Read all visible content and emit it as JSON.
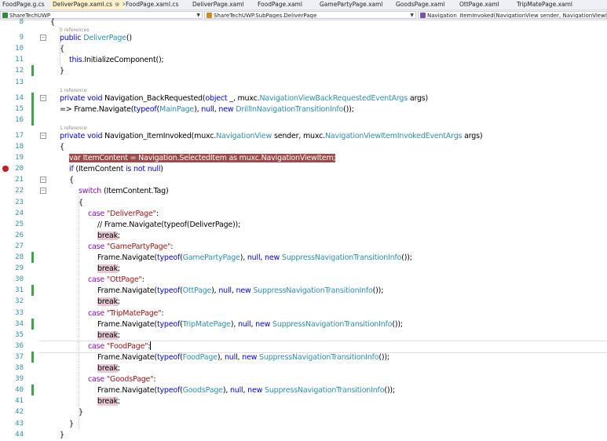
{
  "tabs": [
    {
      "label": "FoodPage.g.cs",
      "active": false
    },
    {
      "label": "DeliverPage.xaml.cs",
      "active": true,
      "pin": "⊕",
      "close": "✕"
    },
    {
      "label": "FoodPage.xaml.cs",
      "active": false
    },
    {
      "label": "DeliverPage.xaml",
      "active": false
    },
    {
      "label": "FoodPage.xaml",
      "active": false
    },
    {
      "label": "GamePartyPage.xaml",
      "active": false
    },
    {
      "label": "GoodsPage.xaml",
      "active": false
    },
    {
      "label": "OttPage.xaml",
      "active": false
    },
    {
      "label": "TripMatePage.xaml",
      "active": false
    }
  ],
  "nav": {
    "project": "ShareTechUWP",
    "class": "ShareTechUWP.SubPages.DeliverPage",
    "member": "Navigation_ItemInvoked(NavigationView sender, NavigationViewItemInvo"
  },
  "colors": {
    "keyword": "#0000ff",
    "type": "#2b91af",
    "string": "#a31515",
    "control": "#8f08c4",
    "changed": "#39a845",
    "highlight": "#9d4a4a"
  },
  "refs": {
    "r0": "0 references",
    "r1": "1 reference",
    "r2": "1 reference"
  },
  "lines": [
    {
      "n": "8",
      "parts": [
        [
          "",
          "{"
        ]
      ]
    },
    {
      "n": "9",
      "parts": [
        [
          "kw",
          "public "
        ],
        [
          "ty",
          "DeliverPage"
        ],
        [
          "",
          "()"
        ]
      ]
    },
    {
      "n": "10",
      "parts": [
        [
          "",
          "{"
        ]
      ]
    },
    {
      "n": "11",
      "parts": [
        [
          "kw",
          "this"
        ],
        [
          "",
          "."
        ],
        [
          "",
          "InitializeComponent();"
        ]
      ]
    },
    {
      "n": "12",
      "parts": [
        [
          "",
          "}"
        ]
      ]
    },
    {
      "n": "13",
      "parts": []
    },
    {
      "n": "14",
      "parts": [
        [
          "kw",
          "private void "
        ],
        [
          "",
          "Navigation_BackRequested("
        ],
        [
          "kw",
          "object "
        ],
        [
          "",
          "_, muxc."
        ],
        [
          "ty",
          "NavigationViewBackRequestedEventArgs"
        ],
        [
          "",
          " args)"
        ]
      ]
    },
    {
      "n": "15",
      "parts": [
        [
          "",
          "=> Frame.Navigate("
        ],
        [
          "kw",
          "typeof"
        ],
        [
          "",
          "("
        ],
        [
          "ty",
          "MainPage"
        ],
        [
          "",
          "), "
        ],
        [
          "kw",
          "null"
        ],
        [
          "",
          ", "
        ],
        [
          "kw",
          "new "
        ],
        [
          "ty",
          "DrillInNavigationTransitionInfo"
        ],
        [
          "",
          "());"
        ]
      ]
    },
    {
      "n": "16",
      "parts": []
    },
    {
      "n": "17",
      "parts": [
        [
          "kw",
          "private void "
        ],
        [
          "",
          "Navigation_ItemInvoked(muxc."
        ],
        [
          "ty",
          "NavigationView"
        ],
        [
          "",
          " sender, muxc."
        ],
        [
          "ty",
          "NavigationViewItemInvokedEventArgs"
        ],
        [
          "",
          " args)"
        ]
      ]
    },
    {
      "n": "18",
      "parts": [
        [
          "",
          "{"
        ]
      ]
    },
    {
      "n": "19",
      "parts": [
        [
          "hl",
          "var ItemContent = Navigation.SelectedItem as muxc.NavigationViewItem;"
        ]
      ]
    },
    {
      "n": "20",
      "parts": [
        [
          "kw",
          "if "
        ],
        [
          "",
          "(ItemContent "
        ],
        [
          "kw",
          "is not null"
        ],
        [
          "",
          ")"
        ]
      ]
    },
    {
      "n": "21",
      "parts": [
        [
          "",
          "{"
        ]
      ]
    },
    {
      "n": "22",
      "parts": [
        [
          "ctl",
          "switch"
        ],
        [
          "",
          " (ItemContent.Tag)"
        ]
      ]
    },
    {
      "n": "23",
      "parts": [
        [
          "",
          "{"
        ]
      ]
    },
    {
      "n": "24",
      "parts": [
        [
          "ctl",
          "case "
        ],
        [
          "st",
          "\"DeliverPage\""
        ],
        [
          "",
          ":"
        ]
      ]
    },
    {
      "n": "25",
      "parts": [
        [
          "",
          "// Frame.Navigate(typeof(DeliverPage));"
        ]
      ]
    },
    {
      "n": "26",
      "parts": [
        [
          "brk",
          "break"
        ],
        [
          "",
          ";"
        ]
      ]
    },
    {
      "n": "27",
      "parts": [
        [
          "ctl",
          "case "
        ],
        [
          "st",
          "\"GamePartyPage\""
        ],
        [
          "",
          ":"
        ]
      ]
    },
    {
      "n": "28",
      "parts": [
        [
          "",
          "Frame.Navigate("
        ],
        [
          "kw",
          "typeof"
        ],
        [
          "",
          "("
        ],
        [
          "ty",
          "GamePartyPage"
        ],
        [
          "",
          "), "
        ],
        [
          "kw",
          "null"
        ],
        [
          "",
          ", "
        ],
        [
          "kw",
          "new "
        ],
        [
          "ty",
          "SuppressNavigationTransitionInfo"
        ],
        [
          "",
          "());"
        ]
      ]
    },
    {
      "n": "29",
      "parts": [
        [
          "brk",
          "break"
        ],
        [
          "",
          ";"
        ]
      ]
    },
    {
      "n": "30",
      "parts": [
        [
          "ctl",
          "case "
        ],
        [
          "st",
          "\"OttPage\""
        ],
        [
          "",
          ":"
        ]
      ]
    },
    {
      "n": "31",
      "parts": [
        [
          "",
          "Frame.Navigate("
        ],
        [
          "kw",
          "typeof"
        ],
        [
          "",
          "("
        ],
        [
          "ty",
          "OttPage"
        ],
        [
          "",
          "), "
        ],
        [
          "kw",
          "null"
        ],
        [
          "",
          ", "
        ],
        [
          "kw",
          "new "
        ],
        [
          "ty",
          "SuppressNavigationTransitionInfo"
        ],
        [
          "",
          "());"
        ]
      ]
    },
    {
      "n": "32",
      "parts": [
        [
          "brk",
          "break"
        ],
        [
          "",
          ";"
        ]
      ]
    },
    {
      "n": "33",
      "parts": [
        [
          "ctl",
          "case "
        ],
        [
          "st",
          "\"TripMatePage\""
        ],
        [
          "",
          ":"
        ]
      ]
    },
    {
      "n": "34",
      "parts": [
        [
          "",
          "Frame.Navigate("
        ],
        [
          "kw",
          "typeof"
        ],
        [
          "",
          "("
        ],
        [
          "ty",
          "TripMatePage"
        ],
        [
          "",
          "), "
        ],
        [
          "kw",
          "null"
        ],
        [
          "",
          ", "
        ],
        [
          "kw",
          "new "
        ],
        [
          "ty",
          "SuppressNavigationTransitionInfo"
        ],
        [
          "",
          "());"
        ]
      ]
    },
    {
      "n": "35",
      "parts": [
        [
          "brk",
          "break"
        ],
        [
          "",
          ";"
        ]
      ]
    },
    {
      "n": "36",
      "parts": [
        [
          "ctl",
          "case "
        ],
        [
          "st",
          "\"FoodPage\""
        ],
        [
          "",
          ":"
        ]
      ]
    },
    {
      "n": "37",
      "parts": [
        [
          "",
          "Frame.Navigate("
        ],
        [
          "kw",
          "typeof"
        ],
        [
          "",
          "("
        ],
        [
          "ty",
          "FoodPage"
        ],
        [
          "",
          "), "
        ],
        [
          "kw",
          "null"
        ],
        [
          "",
          ", "
        ],
        [
          "kw",
          "new "
        ],
        [
          "ty",
          "SuppressNavigationTransitionInfo"
        ],
        [
          "",
          "());"
        ]
      ]
    },
    {
      "n": "38",
      "parts": [
        [
          "brk",
          "break"
        ],
        [
          "",
          ";"
        ]
      ]
    },
    {
      "n": "39",
      "parts": [
        [
          "ctl",
          "case "
        ],
        [
          "st",
          "\"GoodsPage\""
        ],
        [
          "",
          ":"
        ]
      ]
    },
    {
      "n": "40",
      "parts": [
        [
          "",
          "Frame.Navigate("
        ],
        [
          "kw",
          "typeof"
        ],
        [
          "",
          "("
        ],
        [
          "ty",
          "GoodsPage"
        ],
        [
          "",
          "), "
        ],
        [
          "kw",
          "null"
        ],
        [
          "",
          ", "
        ],
        [
          "kw",
          "new "
        ],
        [
          "ty",
          "SuppressNavigationTransitionInfo"
        ],
        [
          "",
          "());"
        ]
      ]
    },
    {
      "n": "41",
      "parts": [
        [
          "brk",
          "break"
        ],
        [
          "",
          ";"
        ]
      ]
    },
    {
      "n": "42",
      "parts": [
        [
          "",
          "}"
        ]
      ]
    },
    {
      "n": "43",
      "parts": [
        [
          "",
          "}"
        ]
      ]
    },
    {
      "n": "44",
      "parts": [
        [
          "",
          "}"
        ]
      ]
    }
  ]
}
